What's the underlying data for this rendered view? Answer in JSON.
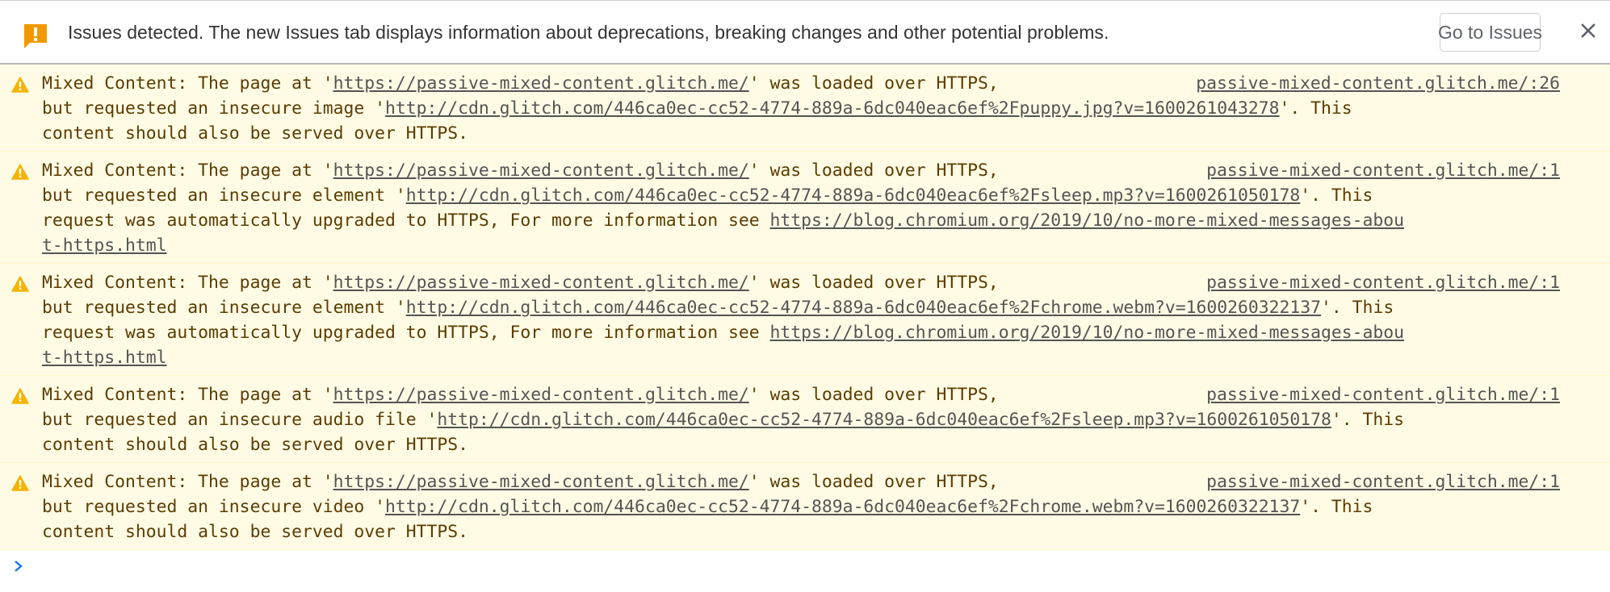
{
  "infobar": {
    "icon": "issue-flag-icon",
    "message": "Issues detected. The new Issues tab displays information about deprecations, breaking changes and other potential problems.",
    "go_button_label": "Go to Issues",
    "close_icon": "close-icon",
    "icon_color": "#f29900"
  },
  "colors": {
    "warning_bg": "#fffbe5",
    "warning_text": "#5c3c00",
    "link_text": "#545454",
    "warning_icon": "#f4b400",
    "prompt_chevron": "#1a73e8"
  },
  "messages": [
    {
      "icon": "warning-icon",
      "source": "passive-mixed-content.glitch.me/:26",
      "lines": [
        [
          {
            "t": "Mixed Content: The page at '"
          },
          {
            "t": "https://passive-mixed-content.glitch.me/",
            "link": true
          },
          {
            "t": "' was loaded over HTTPS,"
          }
        ],
        [
          {
            "t": "but requested an insecure image '"
          },
          {
            "t": "http://cdn.glitch.com/446ca0ec-cc52-4774-889a-6dc040eac6ef%2Fpuppy.jpg?v=1600261043278",
            "link": true
          },
          {
            "t": "'. This"
          }
        ],
        [
          {
            "t": "content should also be served over HTTPS."
          }
        ]
      ]
    },
    {
      "icon": "warning-icon",
      "source": "passive-mixed-content.glitch.me/:1",
      "lines": [
        [
          {
            "t": "Mixed Content: The page at '"
          },
          {
            "t": "https://passive-mixed-content.glitch.me/",
            "link": true
          },
          {
            "t": "' was loaded over HTTPS,"
          }
        ],
        [
          {
            "t": "but requested an insecure element '"
          },
          {
            "t": "http://cdn.glitch.com/446ca0ec-cc52-4774-889a-6dc040eac6ef%2Fsleep.mp3?v=1600261050178",
            "link": true
          },
          {
            "t": "'. This"
          }
        ],
        [
          {
            "t": "request was automatically upgraded to HTTPS, For more information see "
          },
          {
            "t": "https://blog.chromium.org/2019/10/no-more-mixed-messages-abou",
            "link": true
          }
        ],
        [
          {
            "t": "t-https.html",
            "link": true
          }
        ]
      ]
    },
    {
      "icon": "warning-icon",
      "source": "passive-mixed-content.glitch.me/:1",
      "lines": [
        [
          {
            "t": "Mixed Content: The page at '"
          },
          {
            "t": "https://passive-mixed-content.glitch.me/",
            "link": true
          },
          {
            "t": "' was loaded over HTTPS,"
          }
        ],
        [
          {
            "t": "but requested an insecure element '"
          },
          {
            "t": "http://cdn.glitch.com/446ca0ec-cc52-4774-889a-6dc040eac6ef%2Fchrome.webm?v=1600260322137",
            "link": true
          },
          {
            "t": "'. This"
          }
        ],
        [
          {
            "t": "request was automatically upgraded to HTTPS, For more information see "
          },
          {
            "t": "https://blog.chromium.org/2019/10/no-more-mixed-messages-abou",
            "link": true
          }
        ],
        [
          {
            "t": "t-https.html",
            "link": true
          }
        ]
      ]
    },
    {
      "icon": "warning-icon",
      "source": "passive-mixed-content.glitch.me/:1",
      "lines": [
        [
          {
            "t": "Mixed Content: The page at '"
          },
          {
            "t": "https://passive-mixed-content.glitch.me/",
            "link": true
          },
          {
            "t": "' was loaded over HTTPS,"
          }
        ],
        [
          {
            "t": "but requested an insecure audio file '"
          },
          {
            "t": "http://cdn.glitch.com/446ca0ec-cc52-4774-889a-6dc040eac6ef%2Fsleep.mp3?v=1600261050178",
            "link": true
          },
          {
            "t": "'. This"
          }
        ],
        [
          {
            "t": "content should also be served over HTTPS."
          }
        ]
      ]
    },
    {
      "icon": "warning-icon",
      "source": "passive-mixed-content.glitch.me/:1",
      "lines": [
        [
          {
            "t": "Mixed Content: The page at '"
          },
          {
            "t": "https://passive-mixed-content.glitch.me/",
            "link": true
          },
          {
            "t": "' was loaded over HTTPS,"
          }
        ],
        [
          {
            "t": "but requested an insecure video '"
          },
          {
            "t": "http://cdn.glitch.com/446ca0ec-cc52-4774-889a-6dc040eac6ef%2Fchrome.webm?v=1600260322137",
            "link": true
          },
          {
            "t": "'. This"
          }
        ],
        [
          {
            "t": "content should also be served over HTTPS."
          }
        ]
      ]
    }
  ],
  "prompt": {
    "icon": "prompt-chevron-icon",
    "value": ""
  }
}
